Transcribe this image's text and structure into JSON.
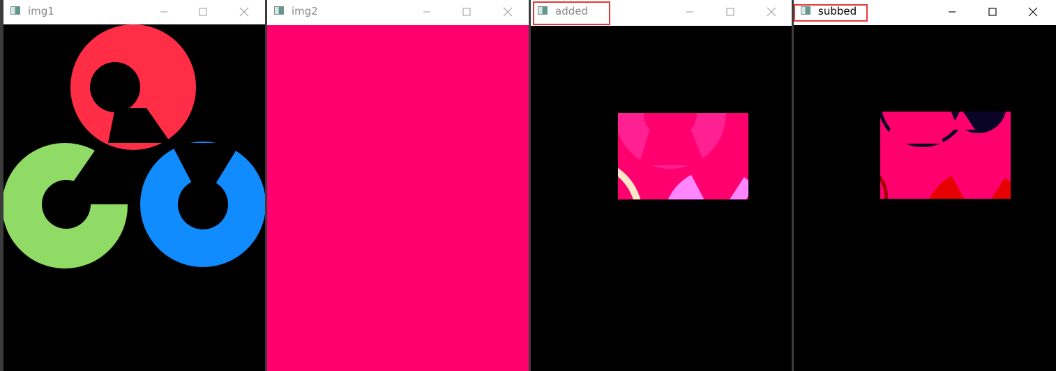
{
  "windows": [
    {
      "title": "img1",
      "icon": "image-window-icon"
    },
    {
      "title": "img2",
      "icon": "image-window-icon"
    },
    {
      "title": "added",
      "icon": "image-window-icon"
    },
    {
      "title": "subbed",
      "icon": "image-window-icon"
    }
  ],
  "controls": [
    "minimize-icon",
    "maximize-icon",
    "close-icon"
  ],
  "colors": {
    "titlebar": "#ffffff",
    "canvas_bg": "#000000",
    "magenta": "#ff006e",
    "red_ring": "#ff2d45",
    "green_ring": "#8fdb66",
    "blue_ring": "#108cff",
    "highlight_box": "#e03b3b"
  }
}
